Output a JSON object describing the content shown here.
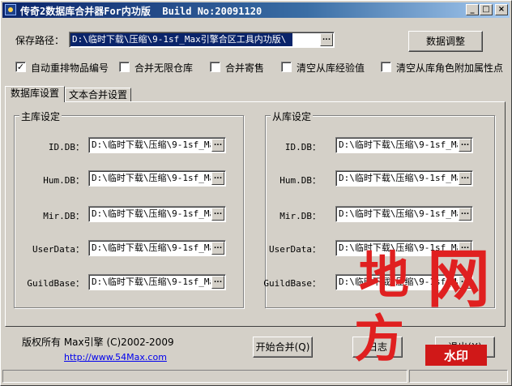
{
  "window": {
    "title": "传奇2数据库合并器For内功版  Build No:20091120",
    "min_glyph": "_",
    "max_glyph": "□",
    "close_glyph": "×"
  },
  "save": {
    "label": "保存路径：",
    "value": "D:\\临时下载\\压缩\\9-1sf_Max引擎合区工具内功版\\",
    "browse": "...",
    "adjust_button": "数据调整"
  },
  "options": [
    {
      "label": "自动重排物品编号",
      "checked": true
    },
    {
      "label": "合并无限仓库",
      "checked": false
    },
    {
      "label": "合并寄售",
      "checked": false
    },
    {
      "label": "清空从库经验值",
      "checked": false
    },
    {
      "label": "清空从库角色附加属性点",
      "checked": false
    }
  ],
  "tabs": [
    {
      "label": "数据库设置",
      "active": true
    },
    {
      "label": "文本合并设置",
      "active": false
    }
  ],
  "main_db": {
    "title": "主库设定",
    "rows": [
      {
        "label": "ID.DB：",
        "value": "D:\\临时下载\\压缩\\9-1sf_Ma",
        "browse": "..."
      },
      {
        "label": "Hum.DB：",
        "value": "D:\\临时下载\\压缩\\9-1sf_Ma",
        "browse": "..."
      },
      {
        "label": "Mir.DB：",
        "value": "D:\\临时下载\\压缩\\9-1sf_Ma",
        "browse": "..."
      },
      {
        "label": "UserData：",
        "value": "D:\\临时下载\\压缩\\9-1sf_Ma",
        "browse": "..."
      },
      {
        "label": "GuildBase：",
        "value": "D:\\临时下载\\压缩\\9-1sf_Ma",
        "browse": "..."
      }
    ]
  },
  "slave_db": {
    "title": "从库设定",
    "rows": [
      {
        "label": "ID.DB：",
        "value": "D:\\临时下载\\压缩\\9-1sf_Ma",
        "browse": "..."
      },
      {
        "label": "Hum.DB：",
        "value": "D:\\临时下载\\压缩\\9-1sf_Ma",
        "browse": "..."
      },
      {
        "label": "Mir.DB：",
        "value": "D:\\临时下载\\压缩\\9-1sf_Ma",
        "browse": "..."
      },
      {
        "label": "UserData：",
        "value": "D:\\临时下载\\压缩\\9-1sf_Ma",
        "browse": "..."
      },
      {
        "label": "GuildBase：",
        "value": "D:\\临时下载\\压缩\\9-1sf_Ma",
        "browse": "..."
      }
    ]
  },
  "footer": {
    "copyright": "版权所有 Max引擎 (C)2002-2009",
    "url": "http://www.54Max.com",
    "start_button": "开始合并(Q)",
    "middle_button": "日志",
    "exit_button": "退出(X)"
  },
  "watermark": {
    "text": "地方网",
    "badge": "水印",
    "color": "#e02020"
  }
}
